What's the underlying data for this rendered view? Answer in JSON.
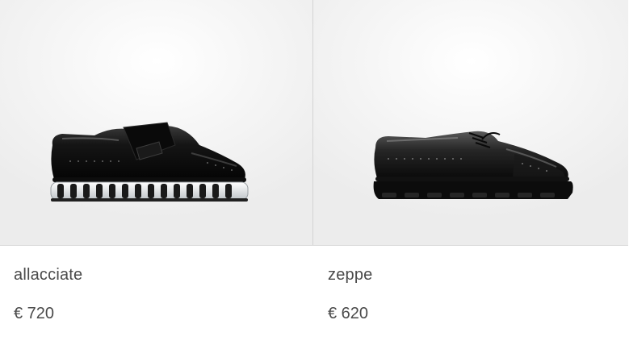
{
  "products": [
    {
      "name": "allacciate",
      "price": "€ 720",
      "image_icon": "strap-brogue-shoe-icon"
    },
    {
      "name": "zeppe",
      "price": "€ 620",
      "image_icon": "lace-up-brogue-shoe-icon"
    }
  ]
}
